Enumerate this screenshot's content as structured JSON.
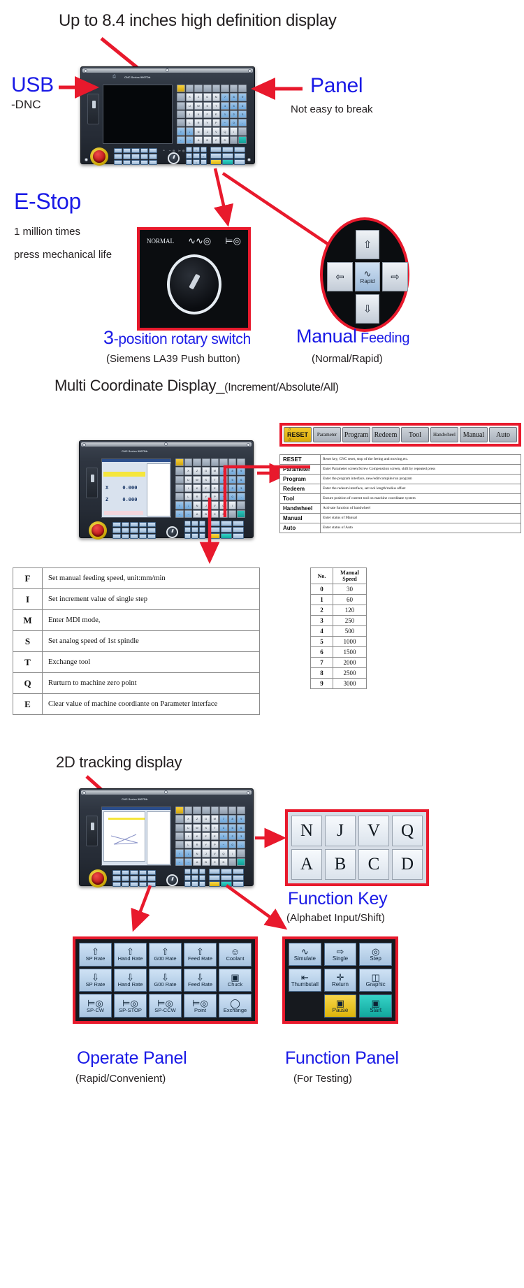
{
  "title_top": "Up to 8.4 inches high definition display",
  "labels": {
    "usb": "USB",
    "usb_sub": "-DNC",
    "panel": "Panel",
    "panel_sub": "Not easy to break",
    "estop": "E-Stop",
    "estop_line1": "1 million times",
    "estop_line2": "press mechanical life",
    "rotary_num": "3",
    "rotary_rest": "-position rotary switch",
    "rotary_sub": "(Siemens LA39 Push button)",
    "manual_big": "Manual",
    "manual_small": " Feeding",
    "manual_sub": "(Normal/Rapid)",
    "multi_coord": "Multi Coordinate Display_",
    "multi_coord_sub": "(Increment/Absolute/All)",
    "tracking": "2D tracking display",
    "function_key": "Function Key",
    "function_key_sub": "(Alphabet Input/Shift)",
    "operate_panel": "Operate Panel",
    "operate_panel_sub": "(Rapid/Convenient)",
    "function_panel": "Function Panel",
    "function_panel_sub": "(For Testing)"
  },
  "colors": {
    "accent_red": "#e8192c",
    "blue_text": "#1a1ae6",
    "black_text": "#231f20",
    "key_yellow": "#e0b40c",
    "key_teal": "#12a79e"
  },
  "device": {
    "brand": "CNC Series 990TDb",
    "coord_x_label": "X",
    "coord_x_value": "0.000",
    "coord_z_label": "Z",
    "coord_z_value": "0.000"
  },
  "mode_strip": {
    "keys": [
      "RESET",
      "Parameter",
      "Program",
      "Redeem",
      "Tool",
      "Handwheel",
      "Manual",
      "Auto"
    ],
    "reset_slash_top": "//",
    "reset_slash_bottom": "//"
  },
  "mode_table": {
    "rows": [
      {
        "key": "RESET",
        "desc": "Reset key, CNC reset, stop of the feeing and moving,etc."
      },
      {
        "key": "Parameter",
        "desc": "Enter Parameter screen/Screw Compenstion screen, shift by repeated press"
      },
      {
        "key": "Program",
        "desc": "Enter the program interface, new/edit/compile/run program"
      },
      {
        "key": "Redeem",
        "desc": "Enter the redeem interface, set tool length/radius offset"
      },
      {
        "key": "Tool",
        "desc": "Ensure position of current tool on machine coordinate system"
      },
      {
        "key": "Handwheel",
        "desc": "Activate function of handwheel"
      },
      {
        "key": "Manual",
        "desc": "Enter status of Manual"
      },
      {
        "key": "Auto",
        "desc": "Enter status of Auto"
      }
    ]
  },
  "fim_table": {
    "rows": [
      {
        "key": "F",
        "desc": "Set manual feeding speed, unit:mm/min"
      },
      {
        "key": "I",
        "desc": "Set increment value of single step"
      },
      {
        "key": "M",
        "desc": "Enter MDI mode,"
      },
      {
        "key": "S",
        "desc": "Set analog speed of 1st spindle"
      },
      {
        "key": "T",
        "desc": "Exchange tool"
      },
      {
        "key": "Q",
        "desc": "Rurturn to machine zero point"
      },
      {
        "key": "E",
        "desc": "Clear value of machine coordiante on Parameter interface"
      }
    ]
  },
  "speed_table": {
    "header_no": "No.",
    "header_speed": "Manual Speed",
    "rows": [
      {
        "no": "0",
        "speed": "30"
      },
      {
        "no": "1",
        "speed": "60"
      },
      {
        "no": "2",
        "speed": "120"
      },
      {
        "no": "3",
        "speed": "250"
      },
      {
        "no": "4",
        "speed": "500"
      },
      {
        "no": "5",
        "speed": "1000"
      },
      {
        "no": "6",
        "speed": "1500"
      },
      {
        "no": "7",
        "speed": "2000"
      },
      {
        "no": "8",
        "speed": "2500"
      },
      {
        "no": "9",
        "speed": "3000"
      }
    ]
  },
  "rotary_switch": {
    "positions": [
      "NORMAL",
      "wave-icon",
      "plug-icon"
    ],
    "normal_label": "NORMAL"
  },
  "arrow_pad": {
    "up": "⇧",
    "down": "⇩",
    "left": "⇦",
    "right": "⇨",
    "center_label": "Rapid",
    "center_glyph": "∿"
  },
  "function_keys": {
    "row1": [
      "N",
      "J",
      "V",
      "Q"
    ],
    "row2": [
      "A",
      "B",
      "C",
      "D"
    ]
  },
  "operate_panel_keys": [
    {
      "glyph": "⇧",
      "label": "SP Rate"
    },
    {
      "glyph": "⇧",
      "label": "Hand Rate"
    },
    {
      "glyph": "⇧",
      "label": "G00 Rate"
    },
    {
      "glyph": "⇧",
      "label": "Feed Rate"
    },
    {
      "glyph": "coolant-icon",
      "label": "Coolant"
    },
    {
      "glyph": "⇩",
      "label": "SP Rate"
    },
    {
      "glyph": "⇩",
      "label": "Hand Rate"
    },
    {
      "glyph": "⇩",
      "label": "G00 Rate"
    },
    {
      "glyph": "⇩",
      "label": "Feed Rate"
    },
    {
      "glyph": "chuck-icon",
      "label": "Chuck"
    },
    {
      "glyph": "spindle-cw-icon",
      "label": "SP-CW"
    },
    {
      "glyph": "spindle-stop-icon",
      "label": "SP-STOP"
    },
    {
      "glyph": "spindle-ccw-icon",
      "label": "SP-CCW"
    },
    {
      "glyph": "point-icon",
      "label": "Point"
    },
    {
      "glyph": "exchange-icon",
      "label": "Exchange"
    }
  ],
  "function_panel_keys": [
    {
      "glyph": "simulate-icon",
      "label": "Simulate",
      "style": "blue"
    },
    {
      "glyph": "single-icon",
      "label": "Single",
      "style": "blue"
    },
    {
      "glyph": "step-icon",
      "label": "Step",
      "style": "blue"
    },
    {
      "glyph": "thumbstall-icon",
      "label": "Thumbstall",
      "style": "blue"
    },
    {
      "glyph": "return-icon",
      "label": "Return",
      "style": "blue"
    },
    {
      "glyph": "graphic-icon",
      "label": "Graphic",
      "style": "blue"
    },
    {
      "glyph": "pause-icon",
      "label": "Pause",
      "style": "yellow"
    },
    {
      "glyph": "start-icon",
      "label": "Start",
      "style": "teal"
    }
  ],
  "keypad_rows": [
    [
      "RESET",
      "Param",
      "Progm",
      "Redm",
      "Tool",
      "Hwhl",
      "Man",
      "Auto"
    ],
    [
      "Input",
      "X",
      "Z",
      "G",
      "M",
      "7",
      "8",
      "9"
    ],
    [
      "Setup",
      "U",
      "W",
      "S",
      "T",
      "4",
      "5",
      "6"
    ],
    [
      "Shift",
      "I",
      "K",
      "F",
      "E",
      "1",
      "2",
      "3"
    ],
    [
      "Page",
      "L",
      "R",
      "Y",
      "P",
      "−",
      "0",
      "."
    ],
    [
      "↑",
      "↓",
      "N",
      "J",
      "V",
      "Q",
      "/",
      "Del"
    ],
    [
      "←",
      "→",
      "A",
      "B",
      "C",
      "D",
      "Esc",
      "Enter"
    ]
  ]
}
